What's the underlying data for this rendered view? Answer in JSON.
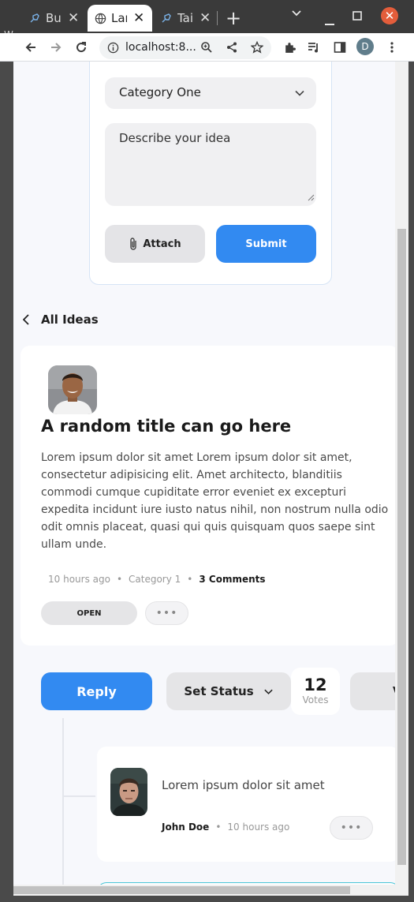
{
  "browser": {
    "tabs": [
      {
        "title": "Bu",
        "active": false
      },
      {
        "title": "Lar",
        "active": true
      },
      {
        "title": "Tai",
        "active": false
      }
    ],
    "window_letter": "W",
    "url": "localhost:8...",
    "profile_initial": "D"
  },
  "form": {
    "category_value": "Category One",
    "description_placeholder": "Describe your idea",
    "attach_label": "Attach",
    "submit_label": "Submit"
  },
  "back_link": {
    "label": "All Ideas"
  },
  "idea": {
    "title": "A random title can go here",
    "body": "Lorem ipsum dolor sit amet Lorem ipsum dolor sit amet, consectetur adipisicing elit. Amet architecto, blanditiis commodi cumque cupiditate error eveniet ex excepturi expedita incidunt iure iusto natus nihil, non nostrum nulla odio odit omnis placeat, quasi qui quis quisquam quos saepe sint ullam unde.",
    "time": "10 hours ago",
    "category": "Category 1",
    "comments": "3 Comments",
    "status": "OPEN",
    "more": "•••"
  },
  "actions": {
    "reply_label": "Reply",
    "set_status_label": "Set Status",
    "votes_count": "12",
    "votes_label": "Votes",
    "vote_button_label": "VO"
  },
  "comments": [
    {
      "text": "Lorem ipsum dolor sit amet",
      "author": "John Doe",
      "time": "10 hours ago",
      "more": "•••"
    }
  ],
  "colors": {
    "accent": "#328af1",
    "background": "#f7f8fc",
    "chrome": "#3a3a3a"
  }
}
